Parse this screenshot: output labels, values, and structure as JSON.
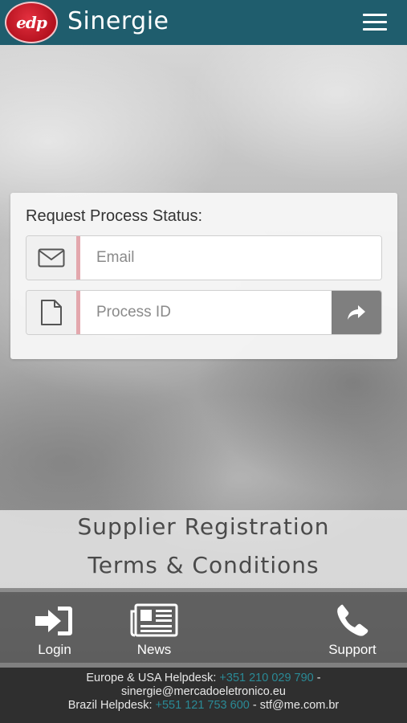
{
  "header": {
    "logo_text": "edp",
    "brand": "Sinergie",
    "menu_icon": "hamburger-menu-icon",
    "bar_color": "#1f5d6d",
    "logo_color": "#c8202d"
  },
  "form": {
    "title": "Request Process Status:",
    "email": {
      "icon": "envelope-icon",
      "placeholder": "Email",
      "value": ""
    },
    "process_id": {
      "icon": "document-icon",
      "placeholder": "Process ID",
      "value": ""
    },
    "submit_icon": "share-arrow-icon",
    "accent_color": "#e3a7ad"
  },
  "links": {
    "supplier_registration": "Supplier Registration",
    "terms": "Terms & Conditions"
  },
  "nav": {
    "login": {
      "label": "Login",
      "icon": "sign-in-icon"
    },
    "news": {
      "label": "News",
      "icon": "newspaper-icon"
    },
    "support": {
      "label": "Support",
      "icon": "phone-icon"
    }
  },
  "footer": {
    "europe_label": "Europe & USA Helpdesk:",
    "europe_phone": "+351 210 029 790",
    "sep1": "-",
    "europe_email": "sinergie@mercadoeletronico.eu",
    "brazil_label": "Brazil Helpdesk:",
    "brazil_phone": "+551 121 753 600",
    "sep2": "-",
    "brazil_email": "stf@me.com.br",
    "phone_color": "#2a8a96"
  }
}
